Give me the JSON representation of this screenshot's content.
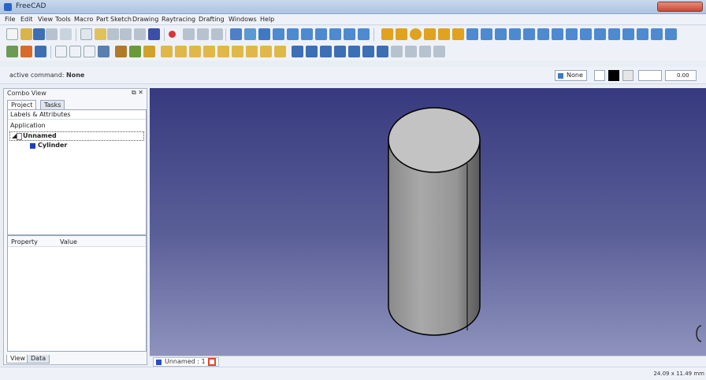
{
  "window": {
    "title": "FreeCAD"
  },
  "menu": [
    "File",
    "Edit",
    "View",
    "Tools",
    "Macro",
    "Part",
    "Sketch",
    "Drawing",
    "Raytracing",
    "Drafting",
    "Windows",
    "Help"
  ],
  "command_bar": {
    "label": "active command:",
    "value": "None",
    "view_button": "None",
    "zoom_value": "0.00"
  },
  "combo_view": {
    "title": "Combo View",
    "tabs": [
      "Project",
      "Tasks"
    ],
    "tree_header": "Labels & Attributes",
    "application_label": "Application",
    "document": "Unnamed",
    "object": "Cylinder",
    "property_header": {
      "property": "Property",
      "value": "Value"
    },
    "bottom_tabs": [
      "View",
      "Data"
    ]
  },
  "document_tab": {
    "label": "Unnamed : 1"
  },
  "status": {
    "dimensions": "24.09 x 11.49 mm"
  },
  "colors": {
    "viewport_top": "#37397e",
    "viewport_bottom": "#8f93bd",
    "cylinder_side": "#9a9a9a",
    "cylinder_top": "#c3c3c3"
  }
}
